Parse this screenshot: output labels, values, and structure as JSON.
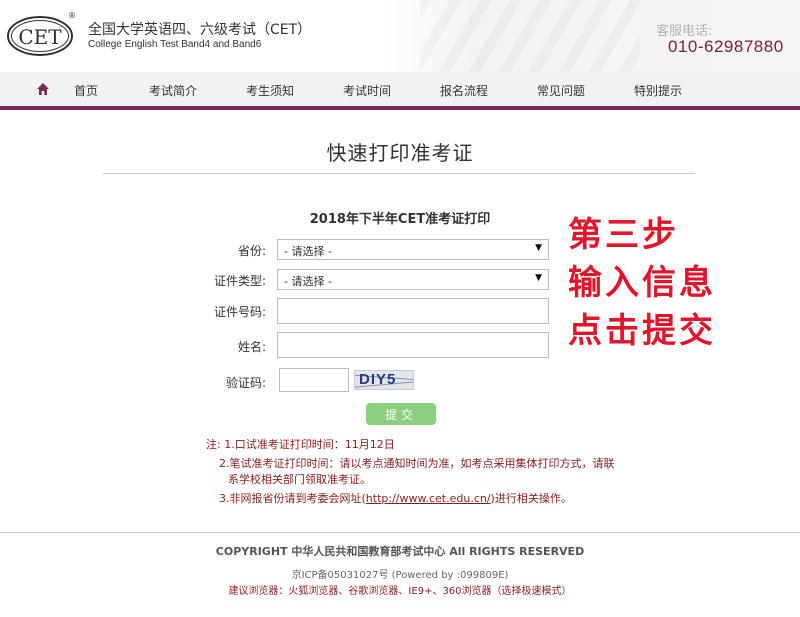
{
  "header": {
    "logo_text": "CET",
    "logo_reg": "®",
    "brand_cn": "全国大学英语四、六级考试（CET）",
    "brand_en": "College English Test Band4 and Band6",
    "hotline_label": "客服电话:",
    "hotline_number": "010-62987880"
  },
  "nav": {
    "home_icon": "home-icon",
    "items": [
      "首页",
      "考试简介",
      "考生须知",
      "考试时间",
      "报名流程",
      "常见问题",
      "特别提示"
    ]
  },
  "main": {
    "title": "快速打印准考证",
    "form_heading": "2018年下半年CET准考证打印",
    "fields": {
      "province": {
        "label": "省份:",
        "value": "- 请选择 -"
      },
      "id_type": {
        "label": "证件类型:",
        "value": "- 请选择 -"
      },
      "id_number": {
        "label": "证件号码:",
        "value": ""
      },
      "name": {
        "label": "姓名:",
        "value": ""
      },
      "captcha": {
        "label": "验证码:",
        "value": "",
        "image_text": "DIY5"
      }
    },
    "submit_label": "提交",
    "step_note": [
      "第三步",
      "输入信息",
      "点击提交"
    ]
  },
  "notes": {
    "line1": "注: 1.口试准考证打印时间：11月12日",
    "line2": "2.笔试准考证打印时间：请以考点通知时间为准，如考点采用集体打印方式，请联",
    "line3": "系学校相关部门领取准考证。",
    "line4_prefix": "3.非网报省份请到考委会网址(",
    "line4_link": "http://www.cet.edu.cn/",
    "line4_suffix": ")进行相关操作。"
  },
  "footer": {
    "copyright": "COPYRIGHT 中华人民共和国教育部考试中心 All RIGHTS RESERVED",
    "icp": "京ICP备05031027号 (Powered by :099809E)",
    "browsers": "建议浏览器：火狐浏览器、谷歌浏览器、IE9+、360浏览器（选择极速模式）"
  },
  "colors": {
    "nav_accent": "#7a2b55",
    "hotline": "#7d1f2a",
    "step_note": "#e0172a",
    "submit": "#8ad07e",
    "notes": "#8a1c1c"
  }
}
